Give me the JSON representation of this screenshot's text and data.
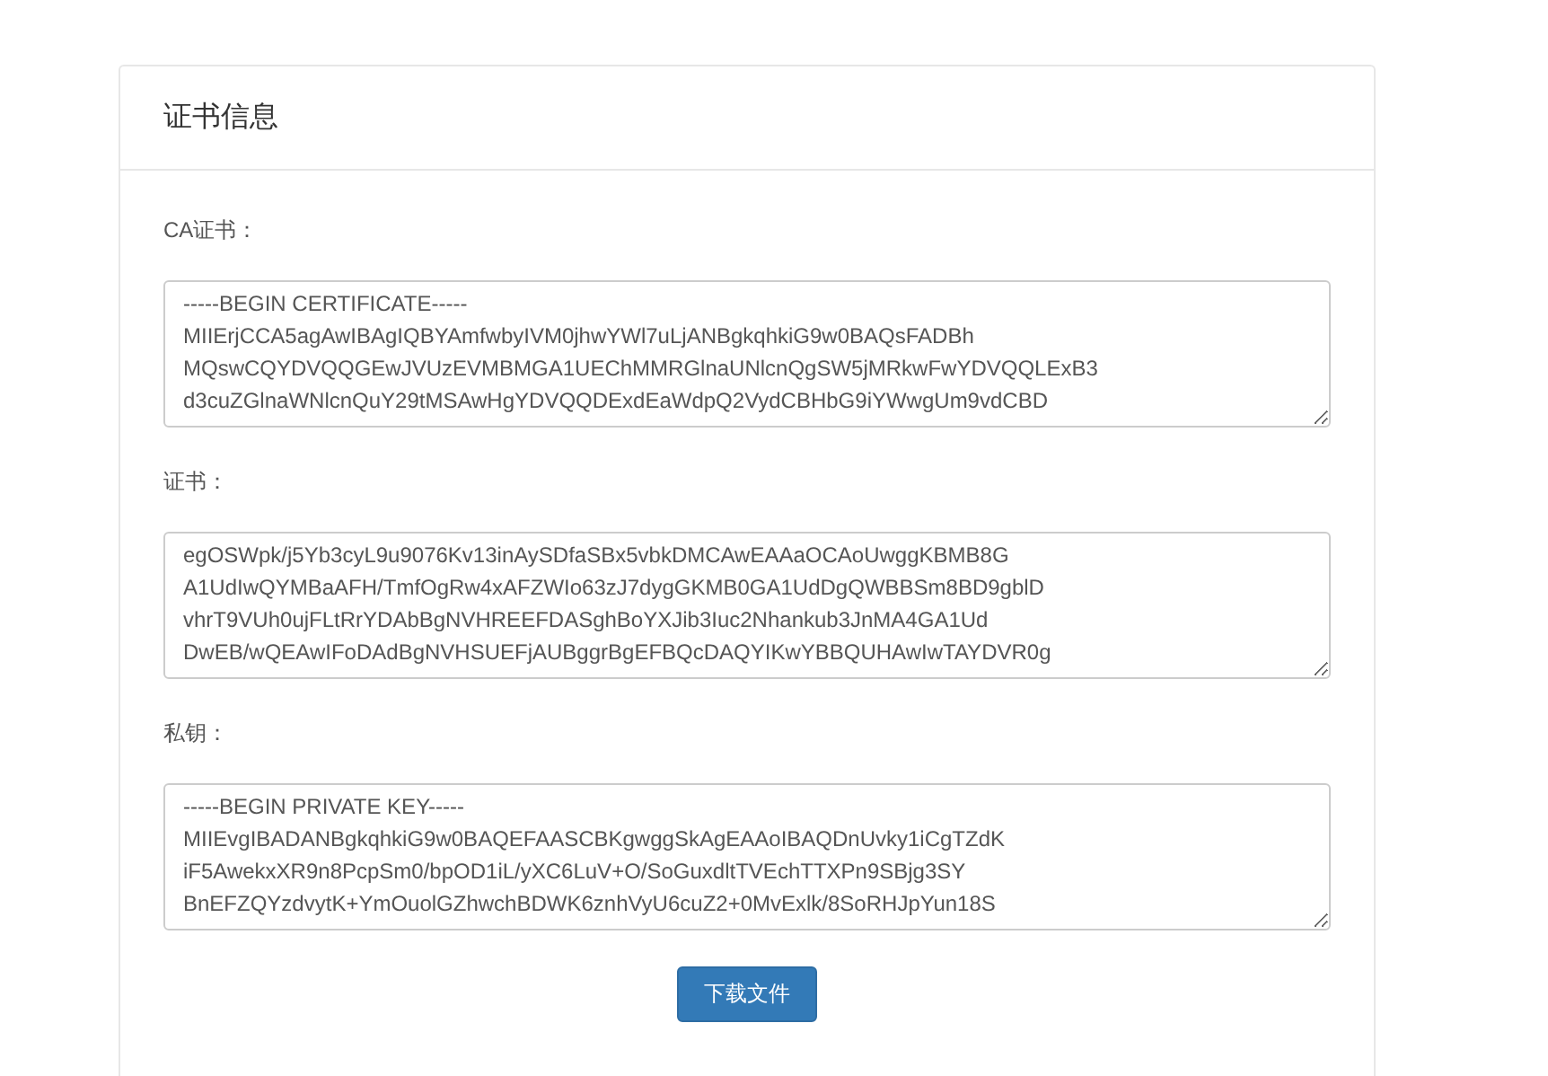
{
  "panel": {
    "title": "证书信息"
  },
  "fields": [
    {
      "label": "CA证书：",
      "value": "-----BEGIN CERTIFICATE-----\nMIIErjCCA5agAwIBAgIQBYAmfwbyIVM0jhwYWl7uLjANBgkqhkiG9w0BAQsFADBh\nMQswCQYDVQQGEwJVUzEVMBMGA1UEChMMRGlnaUNlcnQgSW5jMRkwFwYDVQQLExB3\nd3cuZGlnaWNlcnQuY29tMSAwHgYDVQQDExdEaWdpQ2VydCBHbG9iYWwgUm9vdCBD"
    },
    {
      "label": "证书：",
      "value": "egOSWpk/j5Yb3cyL9u9076Kv13inAySDfaSBx5vbkDMCAwEAAaOCAoUwggKBMB8G\nA1UdIwQYMBaAFH/TmfOgRw4xAFZWIo63zJ7dygGKMB0GA1UdDgQWBBSm8BD9gblD\nvhrT9VUh0ujFLtRrYDAbBgNVHREEFDASghBoYXJib3Iuc2Nhankub3JnMA4GA1Ud\nDwEB/wQEAwIFoDAdBgNVHSUEFjAUBggrBgEFBQcDAQYIKwYBBQUHAwIwTAYDVR0g"
    },
    {
      "label": "私钥：",
      "value": "-----BEGIN PRIVATE KEY-----\nMIIEvgIBADANBgkqhkiG9w0BAQEFAASCBKgwggSkAgEAAoIBAQDnUvky1iCgTZdK\niF5AwekxXR9n8PcpSm0/bpOD1iL/yXC6LuV+O/SoGuxdltTVEchTTXPn9SBjg3SY\nBnEFZQYzdvytK+YmOuolGZhwchBDWK6znhVyU6cuZ2+0MvExlk/8SoRHJpYun18S"
    }
  ],
  "button": {
    "label": "下载文件"
  }
}
